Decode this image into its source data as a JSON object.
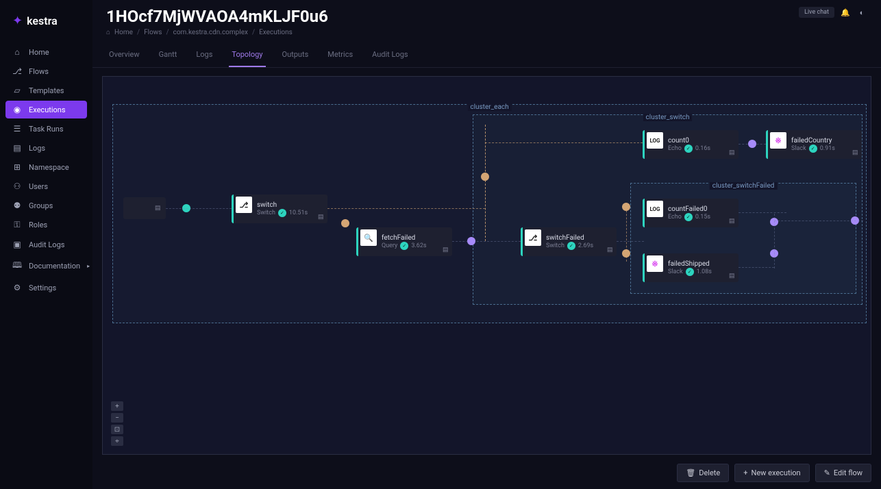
{
  "brand": "kestra",
  "sidebar": {
    "items": [
      {
        "icon": "⌂",
        "label": "Home"
      },
      {
        "icon": "⎇",
        "label": "Flows"
      },
      {
        "icon": "▱",
        "label": "Templates"
      },
      {
        "icon": "◉",
        "label": "Executions"
      },
      {
        "icon": "☰",
        "label": "Task Runs"
      },
      {
        "icon": "▤",
        "label": "Logs"
      },
      {
        "icon": "⊞",
        "label": "Namespace"
      },
      {
        "icon": "⚇",
        "label": "Users"
      },
      {
        "icon": "⚉",
        "label": "Groups"
      },
      {
        "icon": "⚿",
        "label": "Roles"
      },
      {
        "icon": "▣",
        "label": "Audit Logs"
      },
      {
        "icon": "🕮",
        "label": "Documentation",
        "chev": "▸"
      },
      {
        "icon": "⚙",
        "label": "Settings"
      }
    ]
  },
  "header": {
    "title": "1HOcf7MjWVAOA4mKLJF0u6",
    "live_chat": "Live chat"
  },
  "breadcrumb": {
    "home_icon": "⌂",
    "home": "Home",
    "flows": "Flows",
    "namespace": "com.kestra.cdn.complex",
    "current": "Executions"
  },
  "tabs": [
    "Overview",
    "Gantt",
    "Logs",
    "Topology",
    "Outputs",
    "Metrics",
    "Audit Logs"
  ],
  "clusters": {
    "each": "cluster_each",
    "switch": "cluster_switch",
    "switch_failed": "cluster_switchFailed"
  },
  "nodes": {
    "switch": {
      "title": "switch",
      "type": "Switch",
      "time": "10.51s",
      "icon": "⎇"
    },
    "fetchFailed": {
      "title": "fetchFailed",
      "type": "Query",
      "time": "3.62s",
      "icon": "🔍"
    },
    "switchFailed": {
      "title": "switchFailed",
      "type": "Switch",
      "time": "2.69s",
      "icon": "⎇"
    },
    "count0": {
      "title": "count0",
      "type": "Echo",
      "time": "0.16s",
      "icon": "LOG"
    },
    "failedCountry": {
      "title": "failedCountry",
      "type": "Slack",
      "time": "0.91s",
      "icon": "※"
    },
    "countFailed0": {
      "title": "countFailed0",
      "type": "Echo",
      "time": "0.15s",
      "icon": "LOG"
    },
    "failedShipped": {
      "title": "failedShipped",
      "type": "Slack",
      "time": "1.08s",
      "icon": "※"
    }
  },
  "zoom": {
    "in": "+",
    "out": "−",
    "fit": "⊡",
    "reset": "⌖"
  },
  "footer": {
    "delete": "Delete",
    "new_exec": "New execution",
    "edit_flow": "Edit flow"
  }
}
